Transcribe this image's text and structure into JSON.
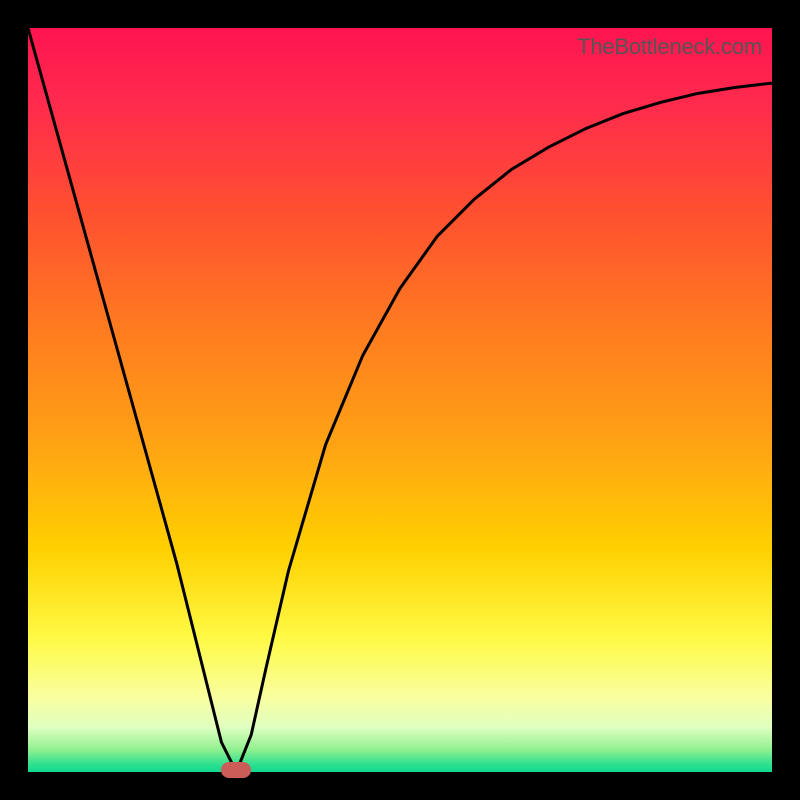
{
  "watermark": "TheBottleneck.com",
  "chart_data": {
    "type": "line",
    "title": "",
    "xlabel": "",
    "ylabel": "",
    "xlim": [
      0,
      100
    ],
    "ylim": [
      0,
      100
    ],
    "grid": false,
    "series": [
      {
        "name": "curve",
        "x": [
          0,
          5,
          10,
          15,
          20,
          24,
          26,
          28,
          30,
          32,
          35,
          40,
          45,
          50,
          55,
          60,
          65,
          70,
          75,
          80,
          85,
          90,
          95,
          100
        ],
        "y": [
          100,
          82,
          64,
          46,
          28,
          12,
          4,
          0,
          5,
          14,
          27,
          44,
          56,
          65,
          72,
          77,
          81,
          84,
          86.5,
          88.5,
          90,
          91.2,
          92,
          92.6
        ]
      }
    ],
    "marker": {
      "x": 28,
      "y": 0,
      "color": "#cc5c58"
    },
    "gradient": {
      "top_color": "#ff1450",
      "bottom_color": "#10d890",
      "stops": [
        "red",
        "orange",
        "yellow",
        "green"
      ]
    }
  }
}
